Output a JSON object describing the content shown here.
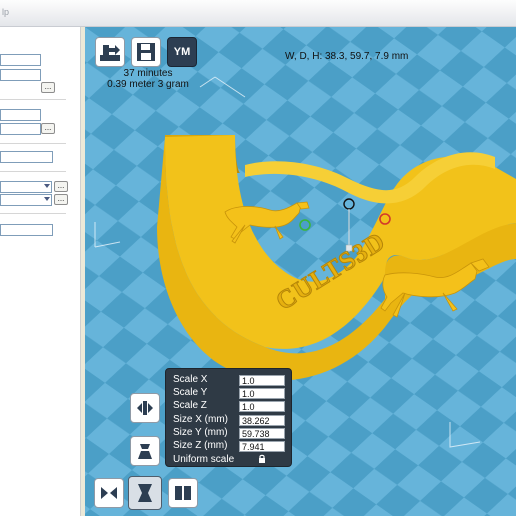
{
  "window": {
    "title_fragment": "lp"
  },
  "toolbar": {
    "load_icon": "load-model-icon",
    "save_icon": "save-toolpath-icon",
    "ym_label": "YM"
  },
  "print_info": {
    "time": "37 minutes",
    "material": "0.39 meter 3 gram"
  },
  "dimensions_readout": "W, D, H: 38.3, 59.7, 7.9 mm",
  "model": {
    "text": "CULTS3D",
    "color": "#f2c21a"
  },
  "scale_panel": {
    "rows": [
      {
        "label": "Scale X",
        "value": "1.0"
      },
      {
        "label": "Scale Y",
        "value": "1.0"
      },
      {
        "label": "Scale Z",
        "value": "1.0"
      },
      {
        "label": "Size X (mm)",
        "value": "38.262"
      },
      {
        "label": "Size Y (mm)",
        "value": "59.738"
      },
      {
        "label": "Size Z (mm)",
        "value": "7.941"
      }
    ],
    "uniform_label": "Uniform scale"
  },
  "left_panel": {
    "browse_label": "..."
  },
  "colors": {
    "viewport_bg": "#4b9fc7",
    "grid_light": "#68b6da",
    "panel_bg": "#2f3a45",
    "model": "#f2c21a"
  }
}
